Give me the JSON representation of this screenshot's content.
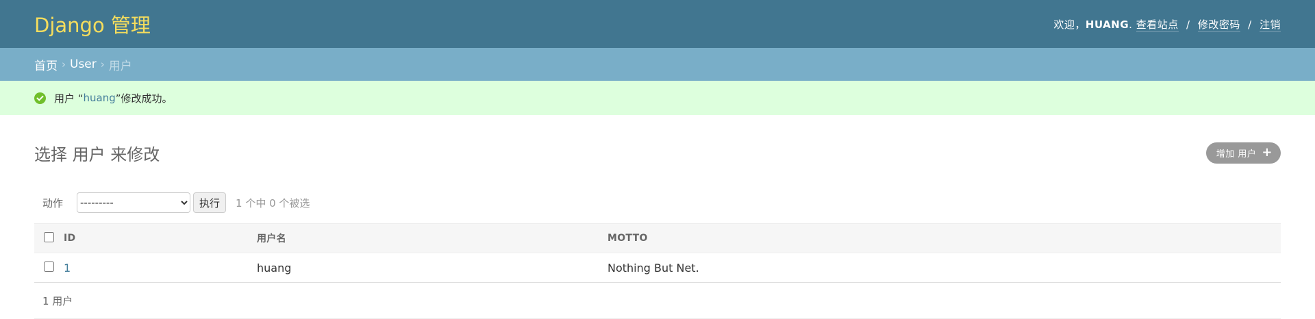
{
  "header": {
    "brand": "Django 管理",
    "welcome": "欢迎，",
    "username": "HUANG",
    "period": ".",
    "links": {
      "view_site": "查看站点",
      "change_password": "修改密码",
      "logout": "注销"
    },
    "separator": "/"
  },
  "breadcrumbs": {
    "home": "首页",
    "app": "User",
    "current": "用户",
    "sep": "›"
  },
  "message": {
    "prefix": "用户 “",
    "link": "huang",
    "suffix": "”修改成功。"
  },
  "main": {
    "title": "选择 用户 来修改",
    "add_button": "增加 用户",
    "actions": {
      "label": "动作",
      "selected_option": "---------",
      "go": "执行",
      "selection": "1 个中 0 个被选"
    },
    "table": {
      "headers": {
        "id": "ID",
        "username": "用户名",
        "motto": "MOTTO"
      },
      "rows": [
        {
          "id": "1",
          "username": "huang",
          "motto": "Nothing But Net."
        }
      ]
    },
    "paginator": "1 用户"
  },
  "colors": {
    "header": "#417690",
    "brand": "#f5dd5d",
    "breadcrumbs": "#79aec8",
    "success": "#ddffdd"
  }
}
